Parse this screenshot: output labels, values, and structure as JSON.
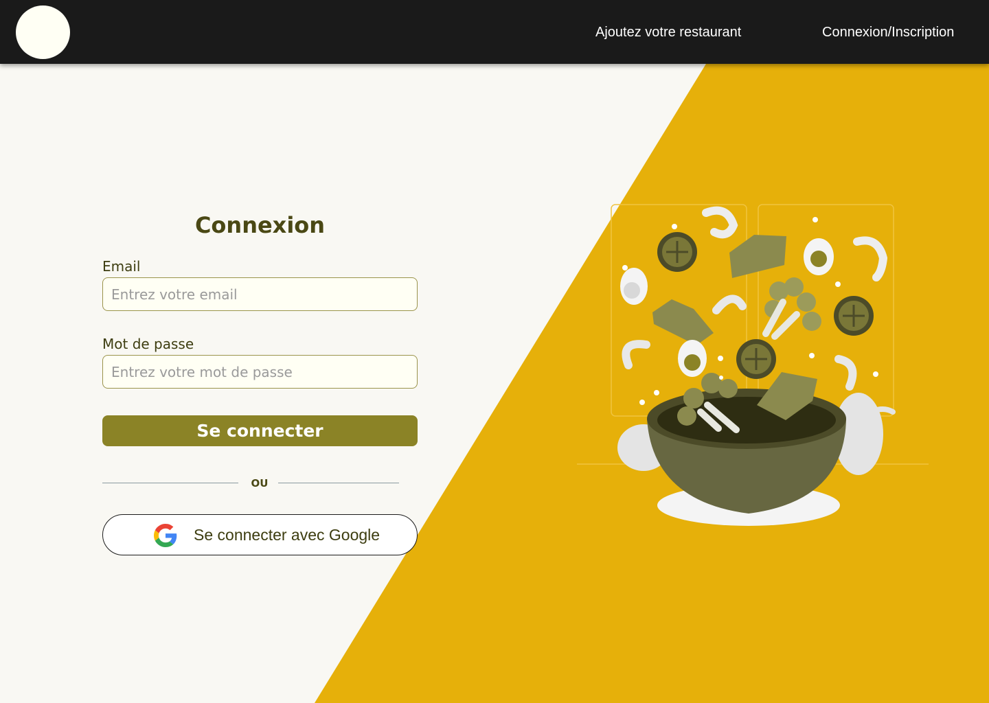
{
  "colors": {
    "background": "#f9f8f3",
    "accent_yellow": "#e6b00a",
    "navbar": "#1a1a1a",
    "primary_button": "#8b8326",
    "title_text": "#4a4814"
  },
  "nav": {
    "logo_icon": "circle-logo",
    "add_restaurant": "Ajoutez votre restaurant",
    "login_signup": "Connexion/Inscription"
  },
  "form": {
    "title": "Connexion",
    "email_label": "Email",
    "email_placeholder": "Entrez votre email",
    "email_value": "",
    "password_label": "Mot de passe",
    "password_placeholder": "Entrez votre mot de passe",
    "password_value": "",
    "submit_label": "Se connecter",
    "divider_text": "OU",
    "google_label": "Se connecter avec Google",
    "google_icon": "google-g-icon"
  },
  "illustration": {
    "icon": "salad-bowl-illustration"
  }
}
